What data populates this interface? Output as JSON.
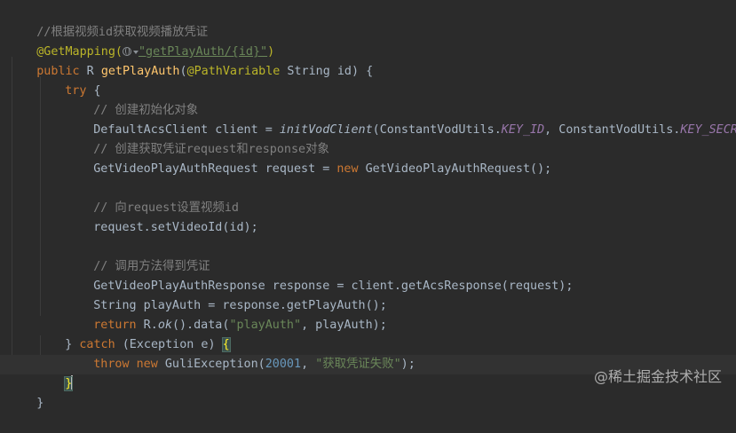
{
  "code": {
    "l1_comment": "//根据视频id获取视频播放凭证",
    "l2_annotation": "@GetMapping(",
    "l2_path": "\"getPlayAuth/{id}\"",
    "l2_close": ")",
    "l3_public": "public",
    "l3_type": " R ",
    "l3_method": "getPlayAuth",
    "l3_paren": "(",
    "l3_pathvar": "@PathVariable",
    "l3_rest": " String id) {",
    "l4_try": "try",
    "l4_brace": " {",
    "l5_comment": "// 创建初始化对象",
    "l6_a": "DefaultAcsClient client = ",
    "l6_call": "initVodClient",
    "l6_b": "(ConstantVodUtils.",
    "l6_key_id": "KEY_ID",
    "l6_c": ", ConstantVodUtils.",
    "l6_key_secret": "KEY_SECRET",
    "l6_d": ");",
    "l7_comment": "// 创建获取凭证request和response对象",
    "l8_a": "GetVideoPlayAuthRequest request = ",
    "l8_new": "new",
    "l8_b": " GetVideoPlayAuthRequest();",
    "l10_comment": "// 向request设置视频id",
    "l11": "request.setVideoId(id);",
    "l13_comment": "// 调用方法得到凭证",
    "l14": "GetVideoPlayAuthResponse response = client.getAcsResponse(request);",
    "l15": "String playAuth = response.getPlayAuth();",
    "l16_return": "return",
    "l16_a": " R.",
    "l16_ok": "ok",
    "l16_b": "().data(",
    "l16_str": "\"playAuth\"",
    "l16_c": ", playAuth);",
    "l17_close": "} ",
    "l17_catch": "catch",
    "l17_mid": " (Exception e) ",
    "l17_brace": "{",
    "l18_throw": "throw",
    "l18_sp": " ",
    "l18_new": "new",
    "l18_a": " GuliException(",
    "l18_num": "20001",
    "l18_b": ", ",
    "l18_str": "\"获取凭证失败\"",
    "l18_c": ");",
    "l19_brace": "}",
    "l20_brace": "}"
  },
  "watermark": "@稀土掘金技术社区",
  "colors": {
    "background": "#2b2b2b",
    "keyword": "#cc7832",
    "annotation": "#bbb529",
    "comment": "#808080",
    "string": "#6a8759",
    "number": "#6897bb",
    "method_declaration": "#ffc66d",
    "static_field": "#9876aa",
    "default_text": "#a9b7c6"
  }
}
